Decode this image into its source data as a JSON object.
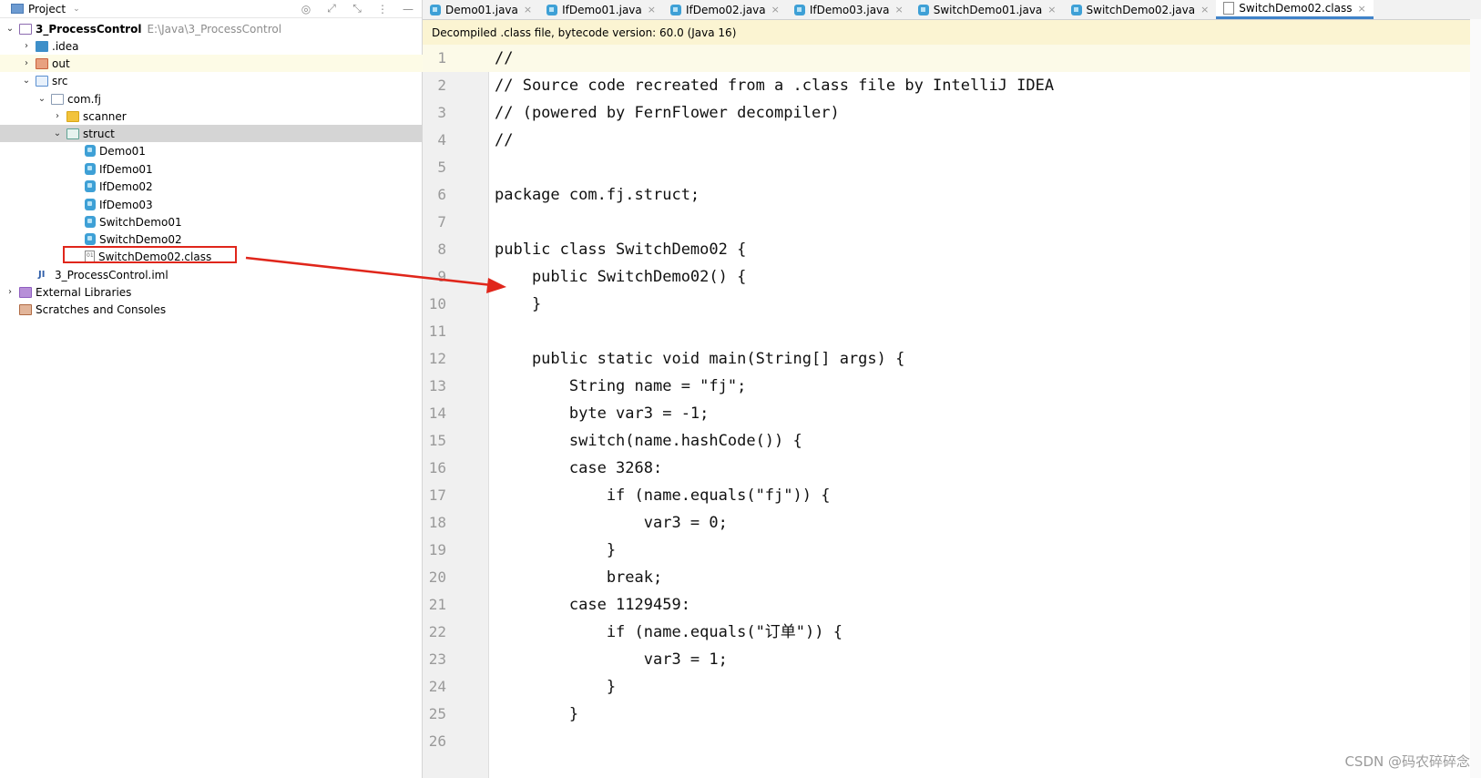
{
  "project_panel": {
    "title": "Project",
    "tree": [
      {
        "label": "3_ProcessControl",
        "path": "E:\\Java\\3_ProcessControl"
      },
      {
        "label": ".idea"
      },
      {
        "label": "out"
      },
      {
        "label": "src"
      },
      {
        "label": "com.fj"
      },
      {
        "label": "scanner"
      },
      {
        "label": "struct"
      },
      {
        "label": "Demo01"
      },
      {
        "label": "IfDemo01"
      },
      {
        "label": "IfDemo02"
      },
      {
        "label": "IfDemo03"
      },
      {
        "label": "SwitchDemo01"
      },
      {
        "label": "SwitchDemo02"
      },
      {
        "label": "SwitchDemo02.class"
      },
      {
        "label": "3_ProcessControl.iml"
      },
      {
        "label": "External Libraries"
      },
      {
        "label": "Scratches and Consoles"
      }
    ]
  },
  "tabs": [
    {
      "label": "Demo01.java"
    },
    {
      "label": "IfDemo01.java"
    },
    {
      "label": "IfDemo02.java"
    },
    {
      "label": "IfDemo03.java"
    },
    {
      "label": "SwitchDemo01.java"
    },
    {
      "label": "SwitchDemo02.java"
    },
    {
      "label": "SwitchDemo02.class"
    }
  ],
  "notice": "Decompiled .class file, bytecode version: 60.0 (Java 16)",
  "code_lines": [
    {
      "n": "1",
      "text": "//"
    },
    {
      "n": "2",
      "text": "// Source code recreated from a .class file by IntelliJ IDEA"
    },
    {
      "n": "3",
      "text": "// (powered by FernFlower decompiler)"
    },
    {
      "n": "4",
      "text": "//"
    },
    {
      "n": "5",
      "text": ""
    },
    {
      "n": "6",
      "text": "package com.fj.struct;"
    },
    {
      "n": "7",
      "text": ""
    },
    {
      "n": "8",
      "text": "public class SwitchDemo02 {"
    },
    {
      "n": "9",
      "text": "    public SwitchDemo02() {"
    },
    {
      "n": "10",
      "text": "    }"
    },
    {
      "n": "11",
      "text": ""
    },
    {
      "n": "12",
      "text": "    public static void main(String[] args) {"
    },
    {
      "n": "13",
      "text": "        String name = \"fj\";"
    },
    {
      "n": "14",
      "text": "        byte var3 = -1;"
    },
    {
      "n": "15",
      "text": "        switch(name.hashCode()) {"
    },
    {
      "n": "16",
      "text": "        case 3268:"
    },
    {
      "n": "17",
      "text": "            if (name.equals(\"fj\")) {"
    },
    {
      "n": "18",
      "text": "                var3 = 0;"
    },
    {
      "n": "19",
      "text": "            }"
    },
    {
      "n": "20",
      "text": "            break;"
    },
    {
      "n": "21",
      "text": "        case 1129459:"
    },
    {
      "n": "22",
      "text": "            if (name.equals(\"订单\")) {"
    },
    {
      "n": "23",
      "text": "                var3 = 1;"
    },
    {
      "n": "24",
      "text": "            }"
    },
    {
      "n": "25",
      "text": "        }"
    },
    {
      "n": "26",
      "text": ""
    }
  ],
  "watermark": "CSDN @码农碎碎念"
}
